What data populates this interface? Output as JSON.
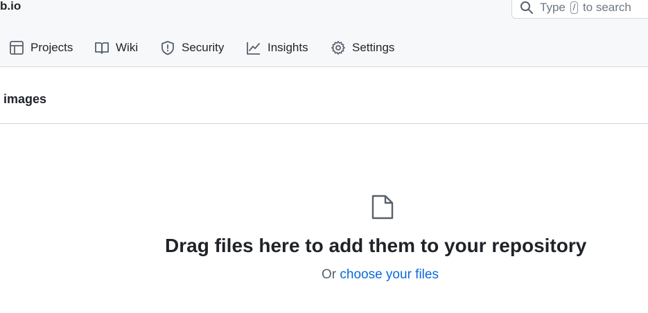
{
  "header": {
    "repo_name": "b.io",
    "search": {
      "prefix": "Type",
      "key": "/",
      "suffix": "to search"
    }
  },
  "nav": {
    "items": [
      {
        "label": "Projects",
        "icon": "table-icon"
      },
      {
        "label": "Wiki",
        "icon": "book-icon"
      },
      {
        "label": "Security",
        "icon": "shield-icon"
      },
      {
        "label": "Insights",
        "icon": "graph-icon"
      },
      {
        "label": "Settings",
        "icon": "gear-icon"
      }
    ]
  },
  "path": {
    "current": "images"
  },
  "upload": {
    "icon": "file-icon",
    "title": "Drag files here to add them to your repository",
    "or_text": "Or",
    "choose_link": "choose your files"
  },
  "colors": {
    "link": "#0969da",
    "header_bg": "#f6f8fa",
    "border": "#d0d7de",
    "text": "#1f2328",
    "muted": "#57606a"
  }
}
